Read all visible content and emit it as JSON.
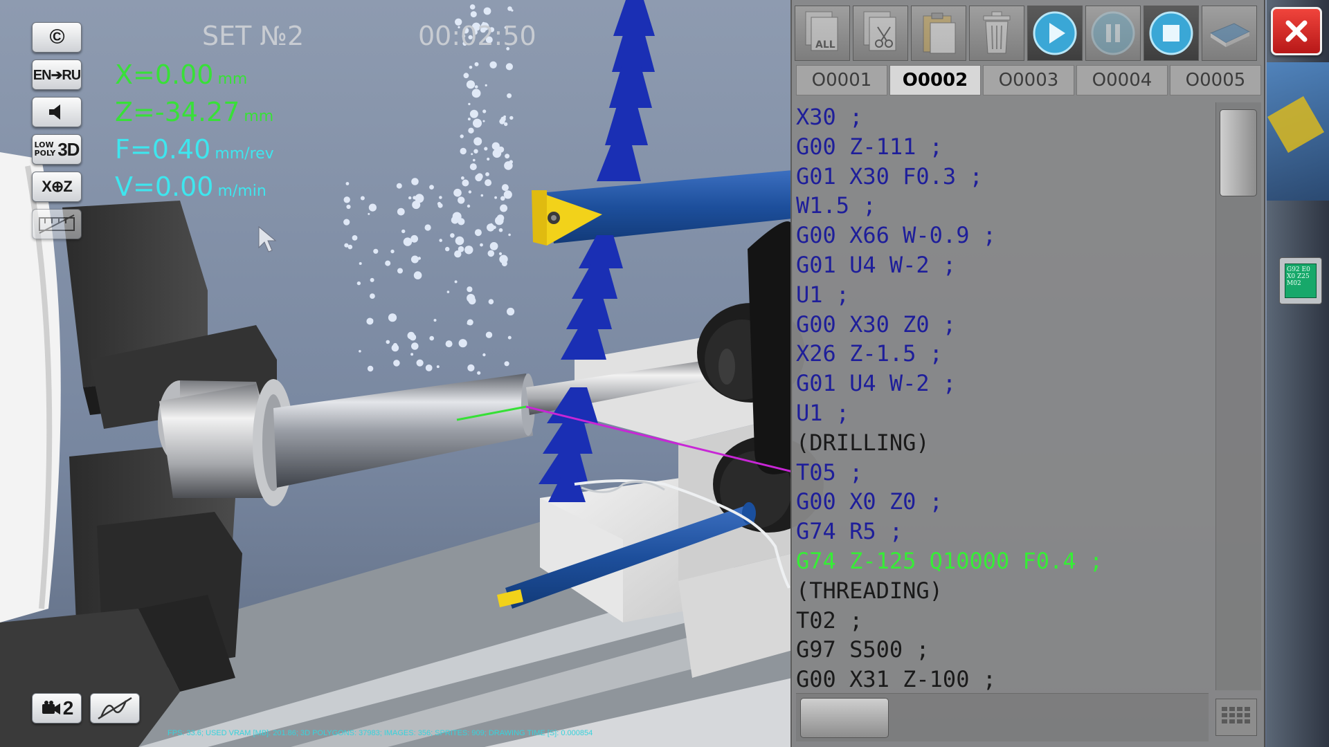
{
  "app": {
    "set_label": "SET №2",
    "timer": "00:02:50"
  },
  "left_toolbar": {
    "copyright_label": "©",
    "language_label": "EN➔RU",
    "sound_icon": "speaker-icon",
    "lowpoly_label_small_top": "LOW",
    "lowpoly_label_small_bottom": "POLY",
    "lowpoly_label_big": "3D",
    "axis_label": "X⊕Z",
    "camera_label": "2",
    "toolpath_icon": "toolpath-off-icon",
    "grid_icon": "measure-off-icon"
  },
  "readouts": {
    "x": {
      "value": "X=0.00",
      "unit": "mm"
    },
    "z": {
      "value": "Z=-34.27",
      "unit": "mm"
    },
    "f": {
      "value": "F=0.40",
      "unit": "mm/rev"
    },
    "v": {
      "value": "V=0.00",
      "unit": "m/min"
    }
  },
  "stats": "FPS: 33.6; USED VRAM [MB]: 201.86; 3D POLYGONS: 37983; IMAGES: 356; SPRITES: 909; DRAWING TIME [S]: 0.000854",
  "program_panel": {
    "toolbar": [
      {
        "name": "select-all-icon",
        "label": "ALL",
        "enabled": false
      },
      {
        "name": "cut-icon",
        "enabled": false
      },
      {
        "name": "paste-icon",
        "enabled": false
      },
      {
        "name": "delete-icon",
        "enabled": false
      },
      {
        "name": "play-icon",
        "enabled": true
      },
      {
        "name": "pause-icon",
        "enabled": false
      },
      {
        "name": "stop-icon",
        "enabled": true
      },
      {
        "name": "book-icon",
        "enabled": false
      }
    ],
    "tabs": [
      {
        "label": "O0001",
        "active": false
      },
      {
        "label": "O0002",
        "active": true
      },
      {
        "label": "O0003",
        "active": false
      },
      {
        "label": "O0004",
        "active": false
      },
      {
        "label": "O0005",
        "active": false
      }
    ],
    "code_lines": [
      {
        "text": "X30 ;",
        "kind": "code"
      },
      {
        "text": "G00 Z-111 ;",
        "kind": "code"
      },
      {
        "text": "G01 X30 F0.3 ;",
        "kind": "code"
      },
      {
        "text": "W1.5 ;",
        "kind": "code"
      },
      {
        "text": "G00 X66 W-0.9 ;",
        "kind": "code"
      },
      {
        "text": "G01 U4 W-2 ;",
        "kind": "code"
      },
      {
        "text": "U1 ;",
        "kind": "code"
      },
      {
        "text": "G00 X30 Z0 ;",
        "kind": "code"
      },
      {
        "text": "X26 Z-1.5 ;",
        "kind": "code"
      },
      {
        "text": "G01 U4 W-2 ;",
        "kind": "code"
      },
      {
        "text": "U1 ;",
        "kind": "code"
      },
      {
        "text": "(DRILLING)",
        "kind": "comment"
      },
      {
        "text": "T05 ;",
        "kind": "code"
      },
      {
        "text": "G00 X0 Z0 ;",
        "kind": "code"
      },
      {
        "text": "G74 R5 ;",
        "kind": "code"
      },
      {
        "text": "G74 Z-125 Q10000 F0.4 ;",
        "kind": "active"
      },
      {
        "text": "(THREADING)",
        "kind": "comment"
      },
      {
        "text": "T02 ;",
        "kind": "comment"
      },
      {
        "text": "G97 S500 ;",
        "kind": "comment"
      },
      {
        "text": "G00 X31 Z-100 ;",
        "kind": "comment"
      }
    ],
    "keypad_icon": "keypad-icon"
  },
  "right_strip": {
    "close_icon": "close-icon",
    "gcode_card_lines": [
      "G92 E0",
      "X0 Z25",
      "M02"
    ]
  },
  "colors": {
    "readout_green": "#38e038",
    "readout_cyan": "#3ee6ee",
    "code_blue": "#1e1e9a",
    "active_line_green": "#36ee36",
    "toolpath_magenta": "#c826d6",
    "drill_blue": "#1a2fb4",
    "insert_yellow": "#f2d21a"
  }
}
